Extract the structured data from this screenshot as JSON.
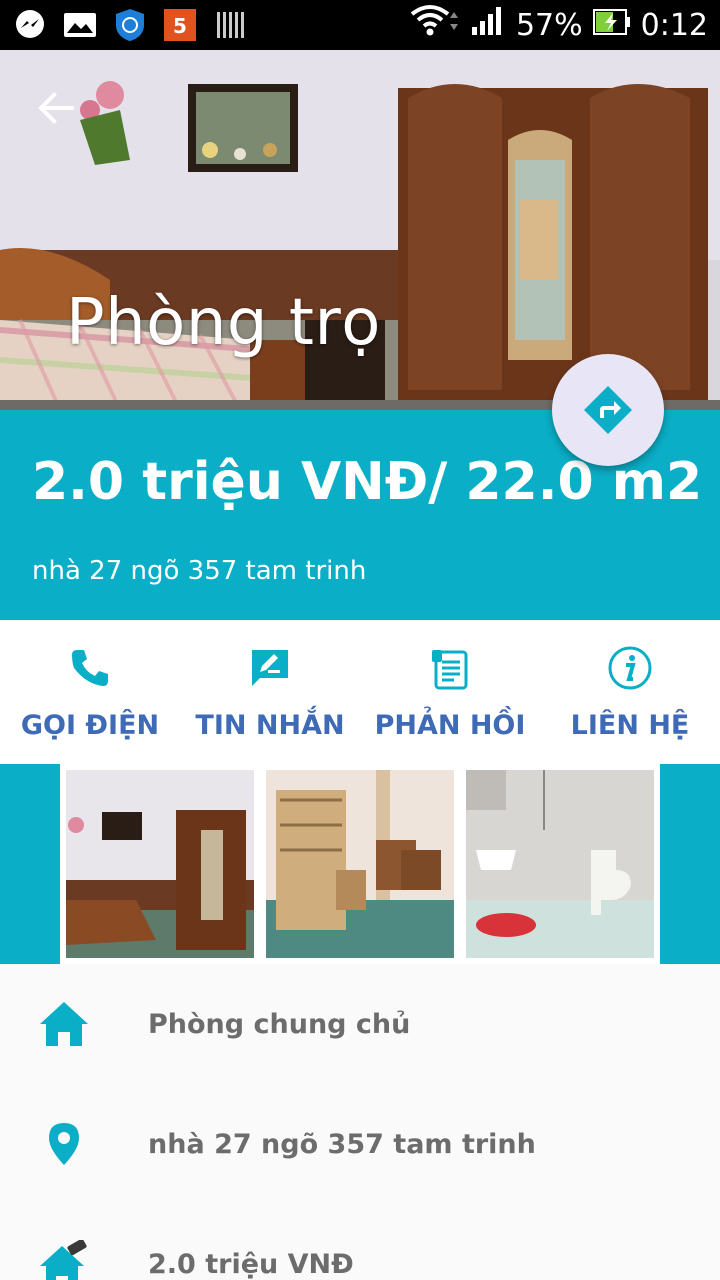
{
  "status_bar": {
    "battery": "57%",
    "time": "0:12",
    "notification_icons": [
      "messenger-icon",
      "gallery-icon",
      "shield-icon",
      "app-5-icon",
      "barcode-icon"
    ]
  },
  "hero": {
    "title": "Phòng trọ"
  },
  "listing": {
    "price_area": "2.0 triệu VNĐ/ 22.0 m2",
    "address": "nhà 27 ngõ 357 tam trinh"
  },
  "actions": [
    {
      "label": "GỌI ĐIỆN",
      "icon": "phone-icon"
    },
    {
      "label": "TIN NHẮN",
      "icon": "message-icon"
    },
    {
      "label": "PHẢN HỒI",
      "icon": "feedback-icon"
    },
    {
      "label": "LIÊN HỆ",
      "icon": "info-icon"
    }
  ],
  "details": [
    {
      "text": "Phòng chung chủ",
      "icon": "home-icon"
    },
    {
      "text": "nhà 27 ngõ 357 tam trinh",
      "icon": "location-pin-icon"
    },
    {
      "text": "2.0 triệu VNĐ",
      "icon": "home-price-icon"
    }
  ],
  "colors": {
    "accent": "#0aaec6",
    "action_label": "#3f6ab5",
    "detail_text": "#6c6c6c"
  }
}
